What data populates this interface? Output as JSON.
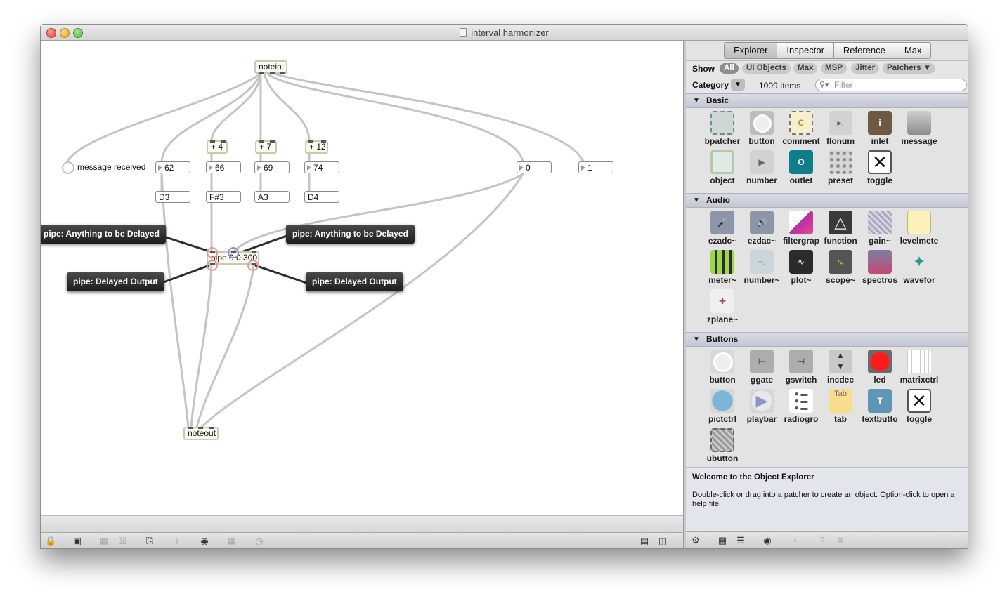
{
  "window": {
    "title": "interval harmonizer"
  },
  "patcher": {
    "objects": {
      "notein": "notein",
      "add4": "+ 4",
      "add7": "+ 7",
      "add12": "+ 12",
      "pipe": "pipe 0 0 300",
      "noteout": "noteout"
    },
    "numbers": {
      "n62": "62",
      "n66": "66",
      "n69": "69",
      "n74": "74",
      "n0": "0",
      "n1": "1"
    },
    "messages": {
      "d3": "D3",
      "fs3": "F#3",
      "a3": "A3",
      "d4": "D4"
    },
    "led_label": "message received",
    "hints": {
      "in_left": "pipe: Anything to be Delayed",
      "in_right": "pipe: Anything to be Delayed",
      "out_left": "pipe: Delayed Output",
      "out_right": "pipe: Delayed Output"
    }
  },
  "sidebar": {
    "tabs": [
      "Explorer",
      "Inspector",
      "Reference",
      "Max"
    ],
    "active_tab": "Explorer",
    "show_label": "Show",
    "filters": [
      "All",
      "UI Objects",
      "Max",
      "MSP",
      "Jitter",
      "Patchers ▼"
    ],
    "active_filter": "All",
    "category_label": "Category",
    "item_count": "1009 Items",
    "filter_placeholder": "Filter",
    "sections": {
      "basic": {
        "title": "Basic",
        "items": [
          "bpatcher",
          "button",
          "comment",
          "flonum",
          "inlet",
          "message",
          "object",
          "number",
          "outlet",
          "preset",
          "toggle"
        ]
      },
      "audio": {
        "title": "Audio",
        "items": [
          "ezadc~",
          "ezdac~",
          "filtergrap",
          "function",
          "gain~",
          "levelmete",
          "meter~",
          "number~",
          "plot~",
          "scope~",
          "spectros",
          "wavefor",
          "zplane~"
        ]
      },
      "buttons": {
        "title": "Buttons",
        "items": [
          "button",
          "ggate",
          "gswitch",
          "incdec",
          "led",
          "matrixctrl",
          "pictctrl",
          "playbar",
          "radiogro",
          "tab",
          "textbutto",
          "toggle",
          "ubutton"
        ]
      }
    },
    "info": {
      "title": "Welcome to the Object Explorer",
      "text": "Double-click or drag into a patcher to create an object. Option-click to open a help file."
    }
  },
  "colors": {
    "accent_red": "#e63946",
    "patch_cord": "#bdbdbd",
    "hint_bg": "#2b2b2b",
    "section_bg": "#c8cbd8"
  }
}
